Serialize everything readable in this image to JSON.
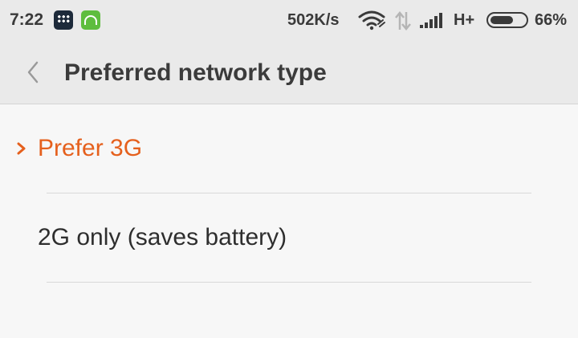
{
  "status_bar": {
    "time": "7:22",
    "notification_icons": [
      "bbm-icon",
      "android-icon"
    ],
    "network_speed": "502K/s",
    "wifi_icon": "wifi-icon",
    "data_activity_icon": "data-arrows-icon",
    "signal_icon": "cell-signal-icon",
    "network_type": "H+",
    "battery_level": 0.66,
    "battery_percent": "66%"
  },
  "header": {
    "back_icon": "chevron-left-icon",
    "title": "Preferred network type"
  },
  "options": [
    {
      "label": "Prefer 3G",
      "selected": true
    },
    {
      "label": "2G only (saves battery)",
      "selected": false
    }
  ],
  "colors": {
    "accent": "#e5601d",
    "background": "#f7f7f7",
    "header_background": "#eaeaea",
    "text": "#2e2e2e"
  }
}
